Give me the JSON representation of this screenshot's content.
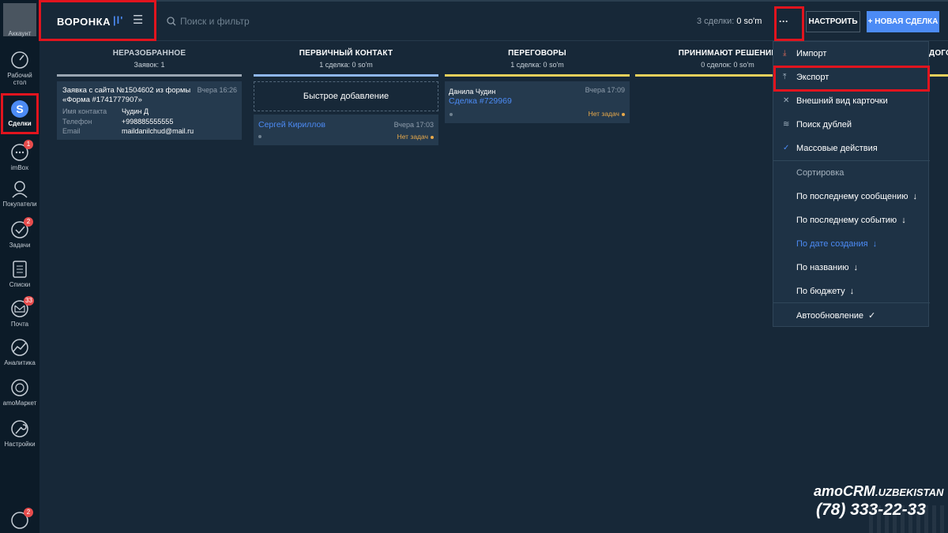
{
  "sidebar": {
    "items": [
      {
        "label": "Аккаунт"
      },
      {
        "label": "Рабочий стол"
      },
      {
        "label": "Сделки"
      },
      {
        "label": "imBox",
        "badge": "1"
      },
      {
        "label": "Покупатели"
      },
      {
        "label": "Задачи",
        "badge": "2"
      },
      {
        "label": "Списки"
      },
      {
        "label": "Почта",
        "badge": "33"
      },
      {
        "label": "Аналитика"
      },
      {
        "label": "amoМаркет"
      },
      {
        "label": "Настройки"
      }
    ],
    "bottom_badge": "2"
  },
  "topbar": {
    "title": "ВОРОНКА",
    "search_placeholder": "Поиск и фильтр",
    "deals_count": "3 сделки:",
    "deals_sum": "0 so'm",
    "more_label": "···",
    "setup_label": "НАСТРОИТЬ",
    "new_deal_label": "+ НОВАЯ СДЕЛКА"
  },
  "columns": [
    {
      "title": "НЕРАЗОБРАННОЕ",
      "subtitle": "Заявок: 1",
      "color": "#9aa6b2"
    },
    {
      "title": "ПЕРВИЧНЫЙ КОНТАКТ",
      "subtitle": "1 сделка: 0 so'm",
      "color": "#8fb7ee"
    },
    {
      "title": "ПЕРЕГОВОРЫ",
      "subtitle": "1 сделка: 0 so'm",
      "color": "#e6cf5b"
    },
    {
      "title": "ПРИНИМАЮТ РЕШЕНИЕ",
      "subtitle": "0 сделок: 0 so'm",
      "color": "#e6cf5b"
    },
    {
      "title": "ДОГО",
      "subtitle": "",
      "color": "#e6cf5b"
    }
  ],
  "unsorted_card": {
    "title_line1": "Заявка с сайта №1504602 из формы",
    "title_line2": "«Форма #1741777907»",
    "time": "Вчера 16:26",
    "fields": [
      {
        "key": "Имя контакта",
        "value": "Чудин Д"
      },
      {
        "key": "Телефон",
        "value": "+998885555555"
      },
      {
        "key": "Email",
        "value": "maildanilchud@mail.ru"
      }
    ]
  },
  "quick_add_label": "Быстрое добавление",
  "contact_card": {
    "name": "Сергей Кириллов",
    "time": "Вчера 17:03",
    "status": "Нет задач"
  },
  "negotiation_card": {
    "contact": "Данила Чудин",
    "time": "Вчера 17:09",
    "deal": "Сделка #729969",
    "status": "Нет задач"
  },
  "menu": {
    "items": [
      {
        "label": "Импорт",
        "icon": "download-icon",
        "glyph": "⤓"
      },
      {
        "label": "Экспорт",
        "icon": "upload-icon",
        "glyph": "⤒"
      },
      {
        "label": "Внешний вид карточки",
        "icon": "tools-icon",
        "glyph": "✕"
      },
      {
        "label": "Поиск дублей",
        "icon": "duplicates-icon",
        "glyph": "≋"
      },
      {
        "label": "Массовые действия",
        "icon": "check-icon",
        "glyph": "✓"
      }
    ],
    "sort_label": "Сортировка",
    "sort_items": [
      {
        "label": "По последнему сообщению",
        "active": false
      },
      {
        "label": "По последнему событию",
        "active": false
      },
      {
        "label": "По дате создания",
        "active": true
      },
      {
        "label": "По названию",
        "active": false
      },
      {
        "label": "По бюджету",
        "active": false
      }
    ],
    "sort_arrow": "↓",
    "autoupdate_label": "Автообновление",
    "autoupdate_check": "✓"
  },
  "watermark": {
    "brand": "amoCRM",
    "suffix": ".UZBEKISTAN",
    "phone": "(78) 333-22-33"
  }
}
